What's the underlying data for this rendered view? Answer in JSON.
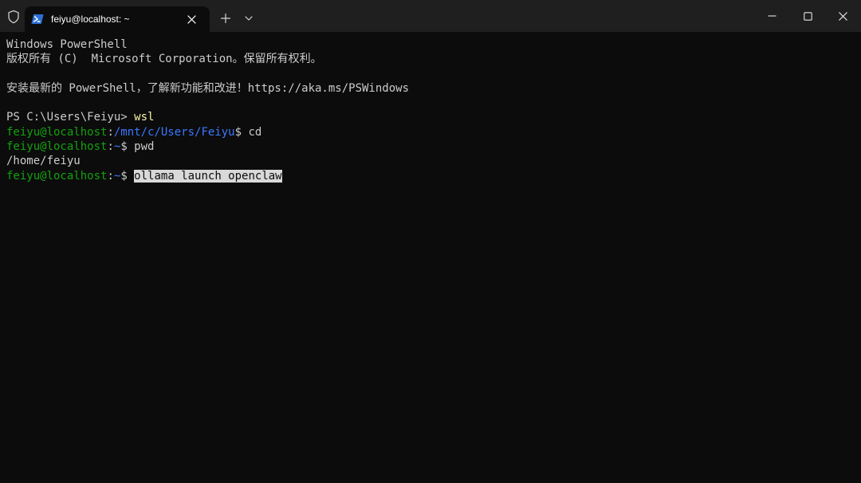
{
  "titlebar": {
    "tab_title": "feiyu@localhost: ~",
    "new_tab_symbol": "+",
    "icons": {
      "shield": "shield-icon",
      "tab": "powershell-icon",
      "close_tab": "close-icon",
      "dropdown": "chevron-down-icon",
      "minimize": "minimize-icon",
      "maximize": "maximize-icon",
      "close_window": "close-icon"
    }
  },
  "terminal": {
    "header1": "Windows PowerShell",
    "header2": "版权所有 (C)  Microsoft Corporation。保留所有权利。",
    "update_msg": "安装最新的 PowerShell，了解新功能和改进！https://aka.ms/PSWindows",
    "ps_prompt": "PS C:\\Users\\Feiyu> ",
    "ps_command": "wsl",
    "prompts": [
      {
        "user": "feiyu@localhost",
        "sep": ":",
        "path": "/mnt/c/Users/Feiyu",
        "dollar": "$ ",
        "command": "cd"
      },
      {
        "user": "feiyu@localhost",
        "sep": ":",
        "path": "~",
        "dollar": "$ ",
        "command": "pwd"
      },
      {
        "user": "feiyu@localhost",
        "sep": ":",
        "path": "~",
        "dollar": "$ ",
        "command": "ollama launch openclaw"
      }
    ],
    "pwd_output": "/home/feiyu"
  },
  "colors": {
    "background": "#0c0c0c",
    "titlebar": "#1f1f1f",
    "text": "#cccccc",
    "prompt_user": "#13a10e",
    "prompt_path": "#3b78ff",
    "command_highlight": "#f9f1a5",
    "selection": "#d9d9d9"
  }
}
